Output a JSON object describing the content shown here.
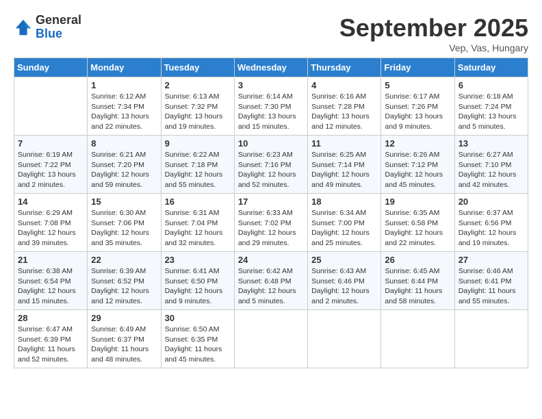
{
  "header": {
    "logo_general": "General",
    "logo_blue": "Blue",
    "month": "September 2025",
    "location": "Vep, Vas, Hungary"
  },
  "days_of_week": [
    "Sunday",
    "Monday",
    "Tuesday",
    "Wednesday",
    "Thursday",
    "Friday",
    "Saturday"
  ],
  "weeks": [
    [
      {
        "day": "",
        "info": ""
      },
      {
        "day": "1",
        "info": "Sunrise: 6:12 AM\nSunset: 7:34 PM\nDaylight: 13 hours\nand 22 minutes."
      },
      {
        "day": "2",
        "info": "Sunrise: 6:13 AM\nSunset: 7:32 PM\nDaylight: 13 hours\nand 19 minutes."
      },
      {
        "day": "3",
        "info": "Sunrise: 6:14 AM\nSunset: 7:30 PM\nDaylight: 13 hours\nand 15 minutes."
      },
      {
        "day": "4",
        "info": "Sunrise: 6:16 AM\nSunset: 7:28 PM\nDaylight: 13 hours\nand 12 minutes."
      },
      {
        "day": "5",
        "info": "Sunrise: 6:17 AM\nSunset: 7:26 PM\nDaylight: 13 hours\nand 9 minutes."
      },
      {
        "day": "6",
        "info": "Sunrise: 6:18 AM\nSunset: 7:24 PM\nDaylight: 13 hours\nand 5 minutes."
      }
    ],
    [
      {
        "day": "7",
        "info": "Sunrise: 6:19 AM\nSunset: 7:22 PM\nDaylight: 13 hours\nand 2 minutes."
      },
      {
        "day": "8",
        "info": "Sunrise: 6:21 AM\nSunset: 7:20 PM\nDaylight: 12 hours\nand 59 minutes."
      },
      {
        "day": "9",
        "info": "Sunrise: 6:22 AM\nSunset: 7:18 PM\nDaylight: 12 hours\nand 55 minutes."
      },
      {
        "day": "10",
        "info": "Sunrise: 6:23 AM\nSunset: 7:16 PM\nDaylight: 12 hours\nand 52 minutes."
      },
      {
        "day": "11",
        "info": "Sunrise: 6:25 AM\nSunset: 7:14 PM\nDaylight: 12 hours\nand 49 minutes."
      },
      {
        "day": "12",
        "info": "Sunrise: 6:26 AM\nSunset: 7:12 PM\nDaylight: 12 hours\nand 45 minutes."
      },
      {
        "day": "13",
        "info": "Sunrise: 6:27 AM\nSunset: 7:10 PM\nDaylight: 12 hours\nand 42 minutes."
      }
    ],
    [
      {
        "day": "14",
        "info": "Sunrise: 6:29 AM\nSunset: 7:08 PM\nDaylight: 12 hours\nand 39 minutes."
      },
      {
        "day": "15",
        "info": "Sunrise: 6:30 AM\nSunset: 7:06 PM\nDaylight: 12 hours\nand 35 minutes."
      },
      {
        "day": "16",
        "info": "Sunrise: 6:31 AM\nSunset: 7:04 PM\nDaylight: 12 hours\nand 32 minutes."
      },
      {
        "day": "17",
        "info": "Sunrise: 6:33 AM\nSunset: 7:02 PM\nDaylight: 12 hours\nand 29 minutes."
      },
      {
        "day": "18",
        "info": "Sunrise: 6:34 AM\nSunset: 7:00 PM\nDaylight: 12 hours\nand 25 minutes."
      },
      {
        "day": "19",
        "info": "Sunrise: 6:35 AM\nSunset: 6:58 PM\nDaylight: 12 hours\nand 22 minutes."
      },
      {
        "day": "20",
        "info": "Sunrise: 6:37 AM\nSunset: 6:56 PM\nDaylight: 12 hours\nand 19 minutes."
      }
    ],
    [
      {
        "day": "21",
        "info": "Sunrise: 6:38 AM\nSunset: 6:54 PM\nDaylight: 12 hours\nand 15 minutes."
      },
      {
        "day": "22",
        "info": "Sunrise: 6:39 AM\nSunset: 6:52 PM\nDaylight: 12 hours\nand 12 minutes."
      },
      {
        "day": "23",
        "info": "Sunrise: 6:41 AM\nSunset: 6:50 PM\nDaylight: 12 hours\nand 9 minutes."
      },
      {
        "day": "24",
        "info": "Sunrise: 6:42 AM\nSunset: 6:48 PM\nDaylight: 12 hours\nand 5 minutes."
      },
      {
        "day": "25",
        "info": "Sunrise: 6:43 AM\nSunset: 6:46 PM\nDaylight: 12 hours\nand 2 minutes."
      },
      {
        "day": "26",
        "info": "Sunrise: 6:45 AM\nSunset: 6:44 PM\nDaylight: 11 hours\nand 58 minutes."
      },
      {
        "day": "27",
        "info": "Sunrise: 6:46 AM\nSunset: 6:41 PM\nDaylight: 11 hours\nand 55 minutes."
      }
    ],
    [
      {
        "day": "28",
        "info": "Sunrise: 6:47 AM\nSunset: 6:39 PM\nDaylight: 11 hours\nand 52 minutes."
      },
      {
        "day": "29",
        "info": "Sunrise: 6:49 AM\nSunset: 6:37 PM\nDaylight: 11 hours\nand 48 minutes."
      },
      {
        "day": "30",
        "info": "Sunrise: 6:50 AM\nSunset: 6:35 PM\nDaylight: 11 hours\nand 45 minutes."
      },
      {
        "day": "",
        "info": ""
      },
      {
        "day": "",
        "info": ""
      },
      {
        "day": "",
        "info": ""
      },
      {
        "day": "",
        "info": ""
      }
    ]
  ]
}
